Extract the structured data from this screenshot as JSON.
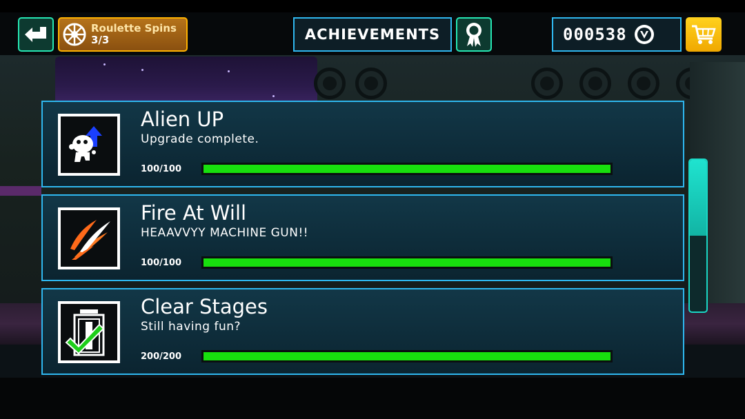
{
  "header": {
    "back_icon": "back-arrow-icon",
    "spins": {
      "title": "Roulette Spins",
      "count": "3/3",
      "icon": "roulette-wheel-icon"
    },
    "title": "ACHIEVEMENTS",
    "award_icon": "award-ribbon-icon",
    "coins": "000538",
    "coin_icon": "coin-icon",
    "cart_icon": "shopping-cart-icon"
  },
  "achievements": [
    {
      "title": "Alien UP",
      "description": "Upgrade complete.",
      "progress": "100/100",
      "fraction": 1.0,
      "icon": "alien-upgrade-icon"
    },
    {
      "title": "Fire At Will",
      "description": "HEAAVVYY MACHINE GUN!!",
      "progress": "100/100",
      "fraction": 1.0,
      "icon": "fire-bullets-icon"
    },
    {
      "title": "Clear Stages",
      "description": "Still having fun?",
      "progress": "200/200",
      "fraction": 1.0,
      "icon": "stage-door-check-icon"
    }
  ],
  "scrollbar": {
    "position_fraction": 0.0,
    "visible_fraction": 0.5
  },
  "colors": {
    "accent": "#2fb8f0",
    "button_green": "#26e8b4",
    "progress": "#18e00e",
    "spins": "#ffb200",
    "cart": "#ffd21e"
  }
}
